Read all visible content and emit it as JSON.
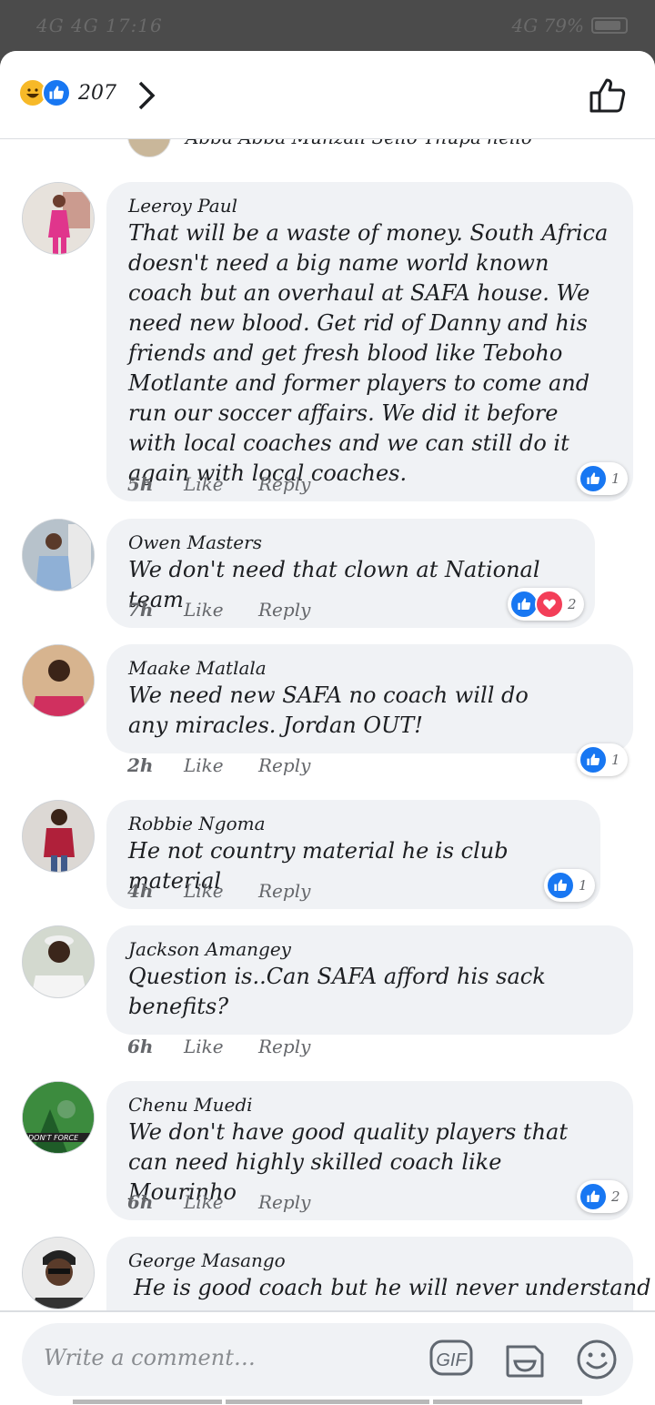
{
  "status_bar": {
    "left": "4G 4G 17:16",
    "right": "4G 79%"
  },
  "header": {
    "reaction_count": "207",
    "reactions": [
      "haha-icon",
      "like-icon"
    ],
    "like_button_icon": "thumbs-up-outline-icon"
  },
  "clipped_comment": {
    "text": "Abba Abba Munzali Sello Thupa hello"
  },
  "comments": [
    {
      "author": "Leeroy Paul",
      "text": "That will be a waste of money. South Africa doesn't need a big name world known coach but an overhaul at SAFA house. We need new blood. Get rid of Danny and his friends and get fresh blood like Teboho Motlante and former players to come and run our soccer affairs. We did it before with local coaches and we can still do it again with local coaches.",
      "time": "5h",
      "like": "Like",
      "reply": "Reply",
      "reaction_count": "1",
      "reactions": [
        "like"
      ]
    },
    {
      "author": "Owen Masters",
      "text": "We don't need that clown at National team",
      "time": "7h",
      "like": "Like",
      "reply": "Reply",
      "reaction_count": "2",
      "reactions": [
        "like",
        "love"
      ]
    },
    {
      "author": "Maake Matlala",
      "text": "We need new SAFA no coach will do any miracles. Jordan OUT!",
      "time": "2h",
      "like": "Like",
      "reply": "Reply",
      "reaction_count": "1",
      "reactions": [
        "like"
      ]
    },
    {
      "author": "Robbie Ngoma",
      "text": "He not country material he is club material",
      "time": "4h",
      "like": "Like",
      "reply": "Reply",
      "reaction_count": "1",
      "reactions": [
        "like"
      ]
    },
    {
      "author": "Jackson Amangey",
      "text": "Question is..Can SAFA afford his sack benefits?",
      "time": "6h",
      "like": "Like",
      "reply": "Reply"
    },
    {
      "author": "Chenu Muedi",
      "text": "We don't have good quality players that can need highly skilled coach like Mourinho",
      "time": "6h",
      "like": "Like",
      "reply": "Reply",
      "reaction_count": "2",
      "reactions": [
        "like"
      ]
    },
    {
      "author": "George Masango",
      "text": "He is good coach but he will never understand"
    }
  ],
  "composer": {
    "placeholder": "Write a comment…",
    "gif_label": "GIF",
    "icons": [
      "gif-icon",
      "sticker-icon",
      "emoji-icon"
    ]
  },
  "colors": {
    "facebook_blue": "#1877f2",
    "love_red": "#f33e58",
    "haha_yellow": "#f7b928",
    "bubble_gray": "#f0f2f5"
  }
}
